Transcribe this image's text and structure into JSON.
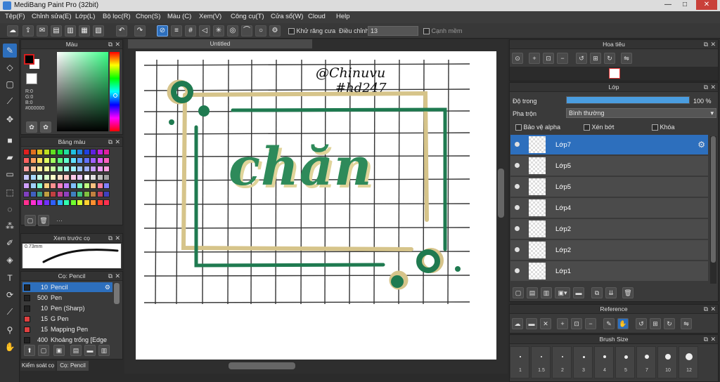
{
  "window": {
    "title": "MediBang Paint Pro (32bit)",
    "min": "—",
    "max": "□",
    "close": "✕"
  },
  "menu": [
    "Tệp(F)",
    "Chỉnh sửa(E)",
    "Lớp(L)",
    "Bộ lọc(R)",
    "Chọn(S)",
    "Màu (C)",
    "Xem(V)",
    "Công cụ(T)",
    "Cửa sổ(W)",
    "Cloud",
    "Help"
  ],
  "toolbar": {
    "antialias_label": "Khử răng cưa",
    "adjust_label": "Điều chỉnh",
    "adjust_value": "13",
    "edge_label": "Cạnh mềm"
  },
  "color_panel": {
    "title": "Màu",
    "r": "R:0",
    "g": "G:0",
    "b": "B:0",
    "hex": "#000000",
    "fg": "#000000",
    "bg": "#ffffff",
    "accent": "#d81e1e"
  },
  "palette": {
    "title": "Bảng màu"
  },
  "brush_preview": {
    "title": "Xem trước cọ",
    "size": "0.73mm"
  },
  "brush_list": {
    "title": "Cọ: Pencil",
    "items": [
      {
        "size": "10",
        "name": "Pencil",
        "color": "#222222",
        "selected": true
      },
      {
        "size": "500",
        "name": "Pen",
        "color": "#222222"
      },
      {
        "size": "10",
        "name": "Pen (Sharp)",
        "color": "#222222"
      },
      {
        "size": "15",
        "name": "G Pen",
        "color": "#e04040"
      },
      {
        "size": "15",
        "name": "Mapping Pen",
        "color": "#e04040"
      },
      {
        "size": "400",
        "name": "Khoảng trống [Edge",
        "color": "#222222"
      }
    ],
    "tab1": "Kiểm soát cọ",
    "tab2": "Cọ: Pencil"
  },
  "document": {
    "tab": "Untitled",
    "signature": "@Chinuvu",
    "hashtag": "#hd247",
    "word": "chăn"
  },
  "navigator": {
    "title": "Hoa tiêu"
  },
  "layers": {
    "title": "Lớp",
    "opacity_label": "Độ trong",
    "opacity_value": "100 %",
    "opacity_fraction": 1.0,
    "blend_label": "Pha trộn",
    "blend_value": "Bình thường",
    "protect_alpha": "Bảo vệ alpha",
    "clip": "Xén bớt",
    "lock": "Khóa",
    "items": [
      "Lớp7",
      "Lớp5",
      "Lớp5",
      "Lớp4",
      "Lớp2",
      "Lớp2",
      "Lớp1"
    ]
  },
  "reference": {
    "title": "Reference"
  },
  "brush_size": {
    "title": "Brush Size",
    "labels": [
      "1",
      "1.5",
      "2",
      "3",
      "4",
      "5",
      "7",
      "10",
      "12"
    ]
  },
  "colors": {
    "selection": "#2d6fbd",
    "green": "#1f7a50",
    "tan": "#d6c48a"
  }
}
